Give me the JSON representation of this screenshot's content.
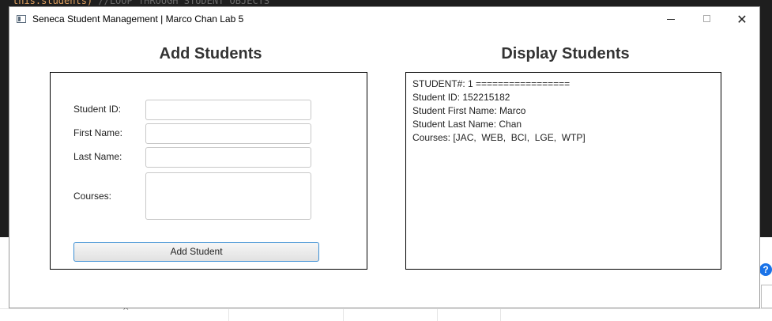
{
  "background": {
    "code_line_code": "this.students)",
    "code_line_comment": " //LOOP THROUGH STUDENT OBJECTS",
    "help_icon_label": "?"
  },
  "window": {
    "title": "Seneca Student Management | Marco Chan Lab 5",
    "controls": {
      "minimize": "minimize-icon",
      "maximize": "maximize-icon",
      "close": "✕"
    }
  },
  "add_section": {
    "heading": "Add Students",
    "fields": {
      "student_id": {
        "label": "Student ID:",
        "value": ""
      },
      "first_name": {
        "label": "First Name:",
        "value": ""
      },
      "last_name": {
        "label": "Last Name:",
        "value": ""
      },
      "courses": {
        "label": "Courses:",
        "value": ""
      }
    },
    "button_label": "Add Student"
  },
  "display_section": {
    "heading": "Display Students",
    "lines": [
      "STUDENT#: 1 =================",
      "Student ID: 152215182",
      "Student First Name: Marco",
      "Student Last Name: Chan",
      "Courses: [JAC,  WEB,  BCI,  LGE,  WTP]"
    ]
  },
  "colors": {
    "accent_border": "#3c8fd4",
    "heading_text": "#333333"
  }
}
